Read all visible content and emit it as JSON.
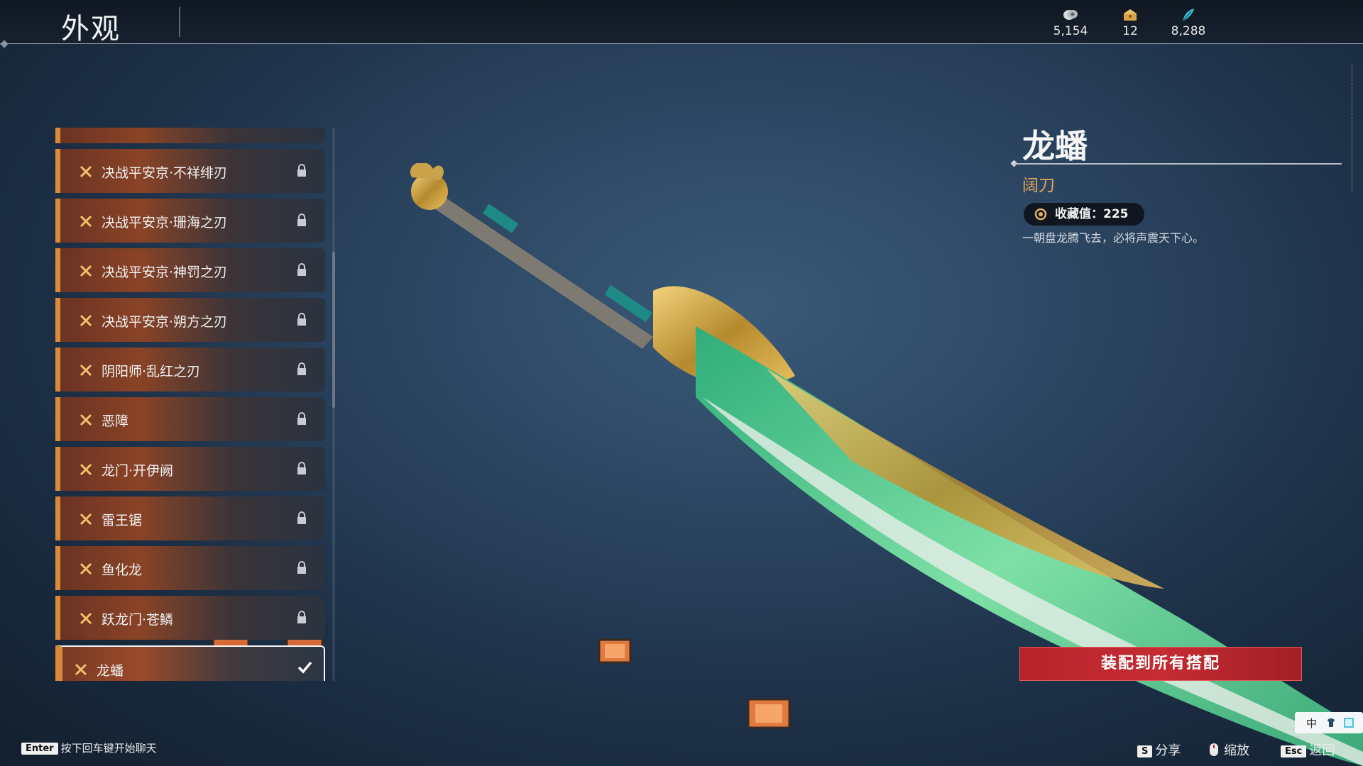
{
  "header": {
    "title": "外观",
    "currencies": [
      {
        "icon": "coin-icon",
        "value": "5,154"
      },
      {
        "icon": "chest-icon",
        "value": "12"
      },
      {
        "icon": "feather-icon",
        "value": "8,288"
      }
    ]
  },
  "list": {
    "partial_item": "",
    "items": [
      {
        "label": "决战平安京·不祥绯刃",
        "locked": true
      },
      {
        "label": "决战平安京·珊海之刃",
        "locked": true
      },
      {
        "label": "决战平安京·神罚之刃",
        "locked": true
      },
      {
        "label": "决战平安京·朔方之刃",
        "locked": true
      },
      {
        "label": "阴阳师·乱红之刃",
        "locked": true
      },
      {
        "label": "恶障",
        "locked": true
      },
      {
        "label": "龙门·开伊阙",
        "locked": true
      },
      {
        "label": "雷王锯",
        "locked": true
      },
      {
        "label": "鱼化龙",
        "locked": true
      },
      {
        "label": "跃龙门·苍鳞",
        "locked": true
      },
      {
        "label": "龙蟠",
        "locked": false,
        "selected": true
      }
    ]
  },
  "detail": {
    "name": "龙蟠",
    "type": "阔刀",
    "collection_label": "收藏值：225",
    "description": "一朝盘龙腾飞去，必将声震天下心。"
  },
  "equip_button": "装配到所有搭配",
  "footer": {
    "chat_key": "Enter",
    "chat_hint": "按下回车键开始聊天",
    "actions": [
      {
        "key": "S",
        "label": "分享"
      },
      {
        "key": "",
        "label": "缩放"
      },
      {
        "key": "Esc",
        "label": "返回"
      }
    ]
  },
  "ime": {
    "mode": "中"
  },
  "colors": {
    "accent": "#d98a3a",
    "equip": "#c42c32",
    "type": "#e0a456"
  }
}
